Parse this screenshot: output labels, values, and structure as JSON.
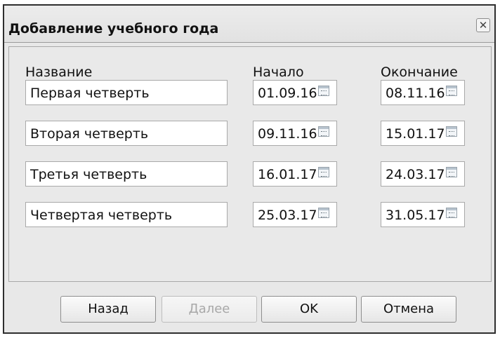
{
  "dialog": {
    "title": "Добавление учебного года",
    "close_icon": "close-icon"
  },
  "columns": {
    "name": "Название",
    "start": "Начало",
    "end": "Окончание"
  },
  "rows": [
    {
      "name": "Первая четверть",
      "start": "01.09.16",
      "end": "08.11.16"
    },
    {
      "name": "Вторая четверть",
      "start": "09.11.16",
      "end": "15.01.17"
    },
    {
      "name": "Третья четверть",
      "start": "16.01.17",
      "end": "24.03.17"
    },
    {
      "name": "Четвертая четверть",
      "start": "25.03.17",
      "end": "31.05.17"
    }
  ],
  "buttons": {
    "back": "Назад",
    "next": "Далее",
    "ok": "OK",
    "cancel": "Отмена"
  },
  "state": {
    "next_disabled": true
  },
  "icons": {
    "calendar": "calendar-icon"
  }
}
